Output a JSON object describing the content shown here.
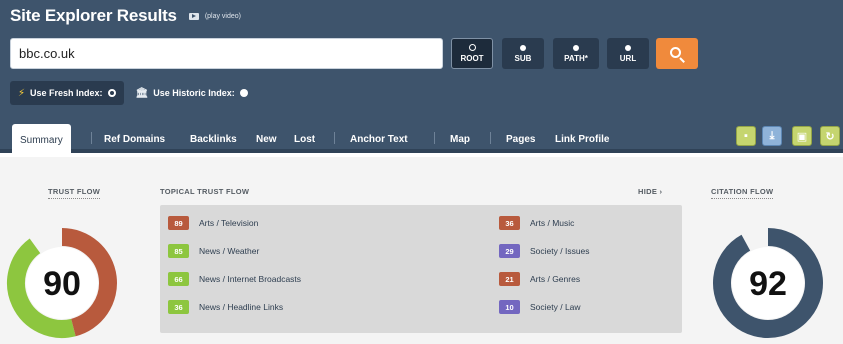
{
  "header": {
    "title": "Site Explorer Results",
    "play_video": "(play video)"
  },
  "search": {
    "value": "bbc.co.uk"
  },
  "scope_buttons": [
    {
      "label": "ROOT",
      "selected": true
    },
    {
      "label": "SUB",
      "selected": false
    },
    {
      "label": "PATH*",
      "selected": false
    },
    {
      "label": "URL",
      "selected": false
    }
  ],
  "index_options": [
    {
      "label": "Use Fresh Index:",
      "selected": true
    },
    {
      "label": "Use Historic Index:",
      "selected": false
    }
  ],
  "tabs": [
    {
      "label": "Summary",
      "active": true
    },
    {
      "label": "Ref Domains"
    },
    {
      "label": "Backlinks"
    },
    {
      "label": "New"
    },
    {
      "label": "Lost"
    },
    {
      "label": "Anchor Text"
    },
    {
      "label": "Map"
    },
    {
      "label": "Pages"
    },
    {
      "label": "Link Profile"
    }
  ],
  "trust_flow": {
    "label": "TRUST FLOW",
    "value": "90",
    "fraction": 0.9,
    "segments": [
      {
        "color": "#b85a3d",
        "fraction": 0.46
      },
      {
        "color": "#8dc63f",
        "fraction": 0.44
      }
    ]
  },
  "topical_trust_flow": {
    "label": "TOPICAL TRUST FLOW",
    "hide_label": "HIDE ›",
    "items_left": [
      {
        "value": "89",
        "topic": "Arts / Television",
        "color": "#b85a3d"
      },
      {
        "value": "85",
        "topic": "News / Weather",
        "color": "#8dc63f"
      },
      {
        "value": "66",
        "topic": "News / Internet Broadcasts",
        "color": "#8dc63f"
      },
      {
        "value": "36",
        "topic": "News / Headline Links",
        "color": "#8dc63f"
      }
    ],
    "items_right": [
      {
        "value": "36",
        "topic": "Arts / Music",
        "color": "#b85a3d"
      },
      {
        "value": "29",
        "topic": "Society / Issues",
        "color": "#7367c0"
      },
      {
        "value": "21",
        "topic": "Arts / Genres",
        "color": "#b85a3d"
      },
      {
        "value": "10",
        "topic": "Society / Law",
        "color": "#7367c0"
      }
    ]
  },
  "citation_flow": {
    "label": "CITATION FLOW",
    "value": "92",
    "fraction": 0.92,
    "color": "#3e546c"
  },
  "colors": {
    "header_bg": "#3e546c",
    "accent_orange": "#f08a3c",
    "panel_bg": "#d9d9d9"
  }
}
